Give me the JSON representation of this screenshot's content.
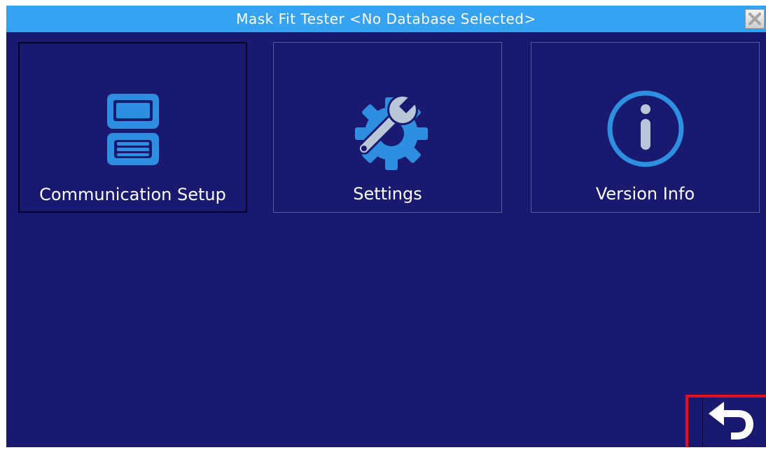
{
  "window": {
    "title": "Mask Fit Tester <No Database Selected>"
  },
  "colors": {
    "titlebar": "#35a2f2",
    "background": "#191970",
    "icon_blue": "#2e8fe0",
    "icon_light": "#b9c6d8",
    "highlight": "#e0102a"
  },
  "tiles": [
    {
      "label": "Communication Setup",
      "icon": "communication-setup-icon",
      "selected": true
    },
    {
      "label": "Settings",
      "icon": "wrench-gear-icon",
      "selected": false
    },
    {
      "label": "Version Info",
      "icon": "info-icon",
      "selected": false
    }
  ],
  "footer": {
    "back_icon": "back-arrow-icon"
  }
}
